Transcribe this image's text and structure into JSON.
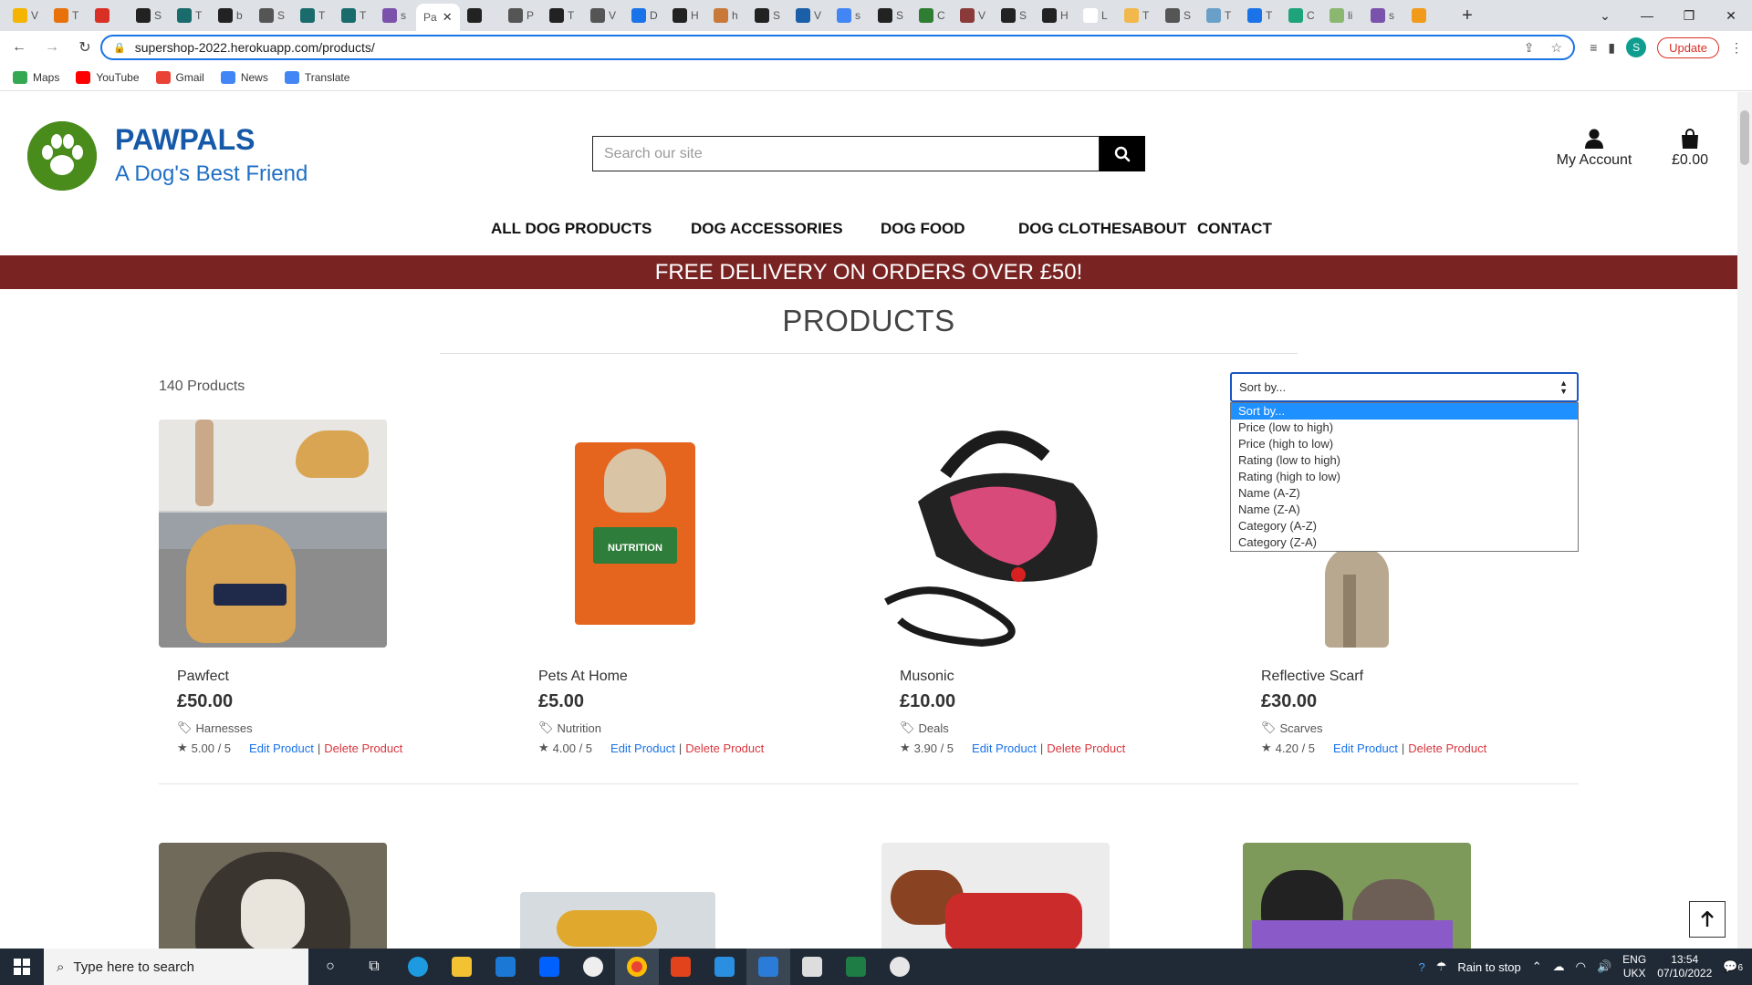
{
  "browser": {
    "tab_letters": [
      "V",
      "T",
      "",
      "S",
      "T",
      "b",
      "S",
      "T",
      "T",
      "s",
      "Pa",
      "",
      "P",
      "T",
      "V",
      "D",
      "H",
      "h",
      "S",
      "V",
      "s",
      "S",
      "C",
      "V",
      "S",
      "H",
      "L",
      "T",
      "S",
      "T",
      "T",
      "C",
      "li",
      "s",
      ""
    ],
    "active_tab_label": "Pa",
    "url": "supershop-2022.herokuapp.com/products/",
    "update_label": "Update",
    "profile_initial": "S",
    "bookmarks": [
      {
        "label": "Maps",
        "color": "#34a853"
      },
      {
        "label": "YouTube",
        "color": "#ff0000"
      },
      {
        "label": "Gmail",
        "color": "#ea4335"
      },
      {
        "label": "News",
        "color": "#4285f4"
      },
      {
        "label": "Translate",
        "color": "#4285f4"
      }
    ]
  },
  "site": {
    "brand_name": "PAWPALS",
    "brand_tagline": "A Dog's Best Friend",
    "search_placeholder": "Search our site",
    "account_label": "My Account",
    "bag_total": "£0.00",
    "nav": [
      "ALL DOG PRODUCTS",
      "DOG ACCESSORIES",
      "DOG FOOD",
      "DOG CLOTHES",
      "ABOUT",
      "CONTACT"
    ],
    "banner": "FREE DELIVERY ON ORDERS OVER £50!",
    "heading": "PRODUCTS",
    "product_count": "140 Products",
    "colors": {
      "brand": "#1559a8",
      "banner": "#7a2323",
      "edit": "#1a73e8",
      "delete": "#d9363e",
      "logo": "#4a8c1c"
    }
  },
  "sort": {
    "current": "Sort by...",
    "options": [
      "Sort by...",
      "Price (low to high)",
      "Price (high to low)",
      "Rating (low to high)",
      "Rating (high to low)",
      "Name (A-Z)",
      "Name (Z-A)",
      "Category (A-Z)",
      "Category (Z-A)"
    ]
  },
  "products": [
    {
      "name": "Pawfect",
      "price": "£50.00",
      "category": "Harnesses",
      "rating": "5.00 / 5",
      "edit": "Edit Product",
      "delete": "Delete Product"
    },
    {
      "name": "Pets At Home",
      "price": "£5.00",
      "category": "Nutrition",
      "rating": "4.00 / 5",
      "edit": "Edit Product",
      "delete": "Delete Product"
    },
    {
      "name": "Musonic",
      "price": "£10.00",
      "category": "Deals",
      "rating": "3.90 / 5",
      "edit": "Edit Product",
      "delete": "Delete Product"
    },
    {
      "name": "Reflective Scarf",
      "price": "£30.00",
      "category": "Scarves",
      "rating": "4.20 / 5",
      "edit": "Edit Product",
      "delete": "Delete Product"
    }
  ],
  "bag_text": "NUTRITION",
  "taskbar": {
    "search_placeholder": "Type here to search",
    "weather": "Rain to stop",
    "lang": "ENG",
    "region": "UKX",
    "time": "13:54",
    "date": "07/10/2022",
    "notifications": "6"
  }
}
